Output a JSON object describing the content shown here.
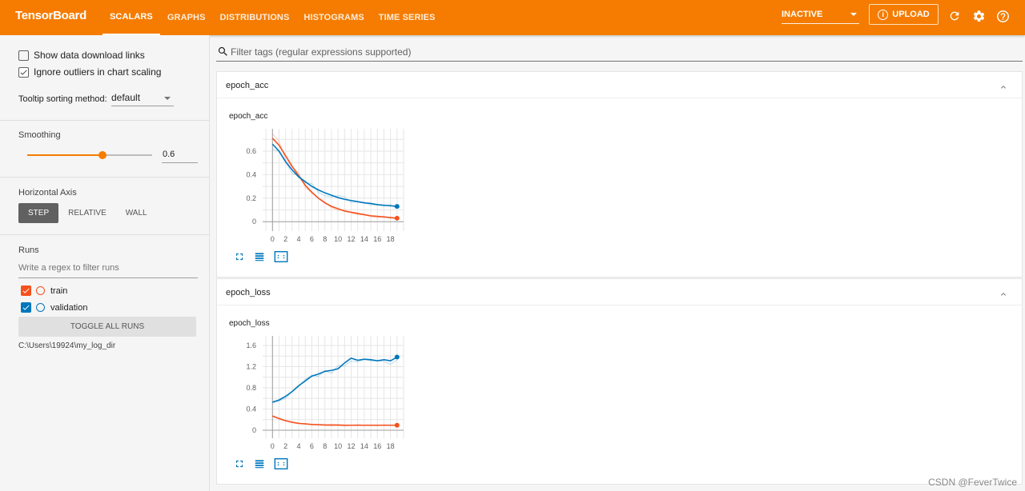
{
  "header": {
    "brand": "TensorBoard",
    "tabs": [
      {
        "label": "SCALARS",
        "active": true
      },
      {
        "label": "GRAPHS"
      },
      {
        "label": "DISTRIBUTIONS"
      },
      {
        "label": "HISTOGRAMS"
      },
      {
        "label": "TIME SERIES"
      }
    ],
    "status_select": "INACTIVE",
    "upload_label": "UPLOAD"
  },
  "sidebar": {
    "show_download_label": "Show data download links",
    "show_download_checked": false,
    "ignore_outliers_label": "Ignore outliers in chart scaling",
    "ignore_outliers_checked": true,
    "tooltip_label": "Tooltip sorting method:",
    "tooltip_value": "default",
    "smoothing_title": "Smoothing",
    "smoothing_value": "0.6",
    "smoothing_fraction": 0.6,
    "horizontal_axis_title": "Horizontal Axis",
    "axis_options": [
      "STEP",
      "RELATIVE",
      "WALL"
    ],
    "axis_selected": "STEP",
    "runs_title": "Runs",
    "runs_filter_placeholder": "Write a regex to filter runs",
    "runs": [
      {
        "name": "train",
        "color": "#f4511e",
        "checked": true
      },
      {
        "name": "validation",
        "color": "#0077bb",
        "checked": true
      }
    ],
    "toggle_all_label": "TOGGLE ALL RUNS",
    "log_dir": "C:\\Users\\19924\\my_log_dir"
  },
  "main": {
    "filter_placeholder": "Filter tags (regular expressions supported)"
  },
  "colors": {
    "accent": "#f57c00",
    "train": "#f4511e",
    "validation": "#0077bb"
  },
  "chart_data": [
    {
      "type": "line",
      "card_title": "epoch_acc",
      "title": "epoch_acc",
      "xlabel": "",
      "ylabel": "",
      "x_ticks": [
        0,
        2,
        4,
        6,
        8,
        10,
        12,
        14,
        16,
        18
      ],
      "y_ticks": [
        0,
        0.2,
        0.4,
        0.6
      ],
      "xlim": [
        -1.5,
        20
      ],
      "ylim": [
        -0.08,
        0.79
      ],
      "grid": true,
      "series": [
        {
          "name": "train",
          "color": "#f4511e",
          "x": [
            0,
            1,
            2,
            3,
            4,
            5,
            6,
            7,
            8,
            9,
            10,
            11,
            12,
            13,
            14,
            15,
            16,
            17,
            18,
            19
          ],
          "values": [
            0.71,
            0.65,
            0.56,
            0.47,
            0.39,
            0.31,
            0.25,
            0.2,
            0.16,
            0.13,
            0.11,
            0.09,
            0.08,
            0.07,
            0.06,
            0.05,
            0.045,
            0.04,
            0.035,
            0.03
          ]
        },
        {
          "name": "validation",
          "color": "#0077bb",
          "x": [
            0,
            1,
            2,
            3,
            4,
            5,
            6,
            7,
            8,
            9,
            10,
            11,
            12,
            13,
            14,
            15,
            16,
            17,
            18,
            19
          ],
          "values": [
            0.66,
            0.6,
            0.51,
            0.44,
            0.38,
            0.34,
            0.3,
            0.27,
            0.245,
            0.225,
            0.205,
            0.19,
            0.18,
            0.17,
            0.16,
            0.155,
            0.145,
            0.14,
            0.135,
            0.13
          ]
        }
      ]
    },
    {
      "type": "line",
      "card_title": "epoch_loss",
      "title": "epoch_loss",
      "xlabel": "",
      "ylabel": "",
      "x_ticks": [
        0,
        2,
        4,
        6,
        8,
        10,
        12,
        14,
        16,
        18
      ],
      "y_ticks": [
        0,
        0.4,
        0.8,
        1.2,
        1.6
      ],
      "xlim": [
        -1.5,
        20
      ],
      "ylim": [
        -0.15,
        1.78
      ],
      "grid": true,
      "series": [
        {
          "name": "train",
          "color": "#f4511e",
          "x": [
            0,
            1,
            2,
            3,
            4,
            5,
            6,
            7,
            8,
            9,
            10,
            11,
            12,
            13,
            14,
            15,
            16,
            17,
            18,
            19
          ],
          "values": [
            0.27,
            0.22,
            0.18,
            0.15,
            0.13,
            0.12,
            0.11,
            0.105,
            0.1,
            0.1,
            0.1,
            0.095,
            0.095,
            0.095,
            0.095,
            0.095,
            0.095,
            0.095,
            0.095,
            0.095
          ]
        },
        {
          "name": "validation",
          "color": "#0077bb",
          "x": [
            0,
            1,
            2,
            3,
            4,
            5,
            6,
            7,
            8,
            9,
            10,
            11,
            12,
            13,
            14,
            15,
            16,
            17,
            18,
            19
          ],
          "values": [
            0.53,
            0.57,
            0.64,
            0.73,
            0.84,
            0.93,
            1.02,
            1.06,
            1.11,
            1.13,
            1.16,
            1.27,
            1.36,
            1.32,
            1.34,
            1.33,
            1.31,
            1.33,
            1.31,
            1.38
          ]
        }
      ]
    }
  ],
  "watermark": "CSDN @FeverTwice"
}
